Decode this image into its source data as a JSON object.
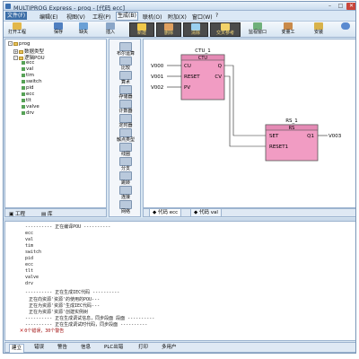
{
  "window": {
    "title": "MULTIPROG Express - prog - [代码 ecc]"
  },
  "menu": {
    "items": [
      "文件(F)",
      "编辑(E)",
      "视图(V)",
      "工程(P)",
      "生成(B)",
      "联机(O)",
      "附加(X)",
      "窗口(W)",
      "?"
    ]
  },
  "toolbar": {
    "buttons": [
      "打开工程",
      "保存",
      "缺失",
      "插入",
      "新建",
      "删除",
      "清除",
      "交叉参考",
      "监视窗口",
      "变量工",
      "安装"
    ]
  },
  "tree": {
    "root": "prog",
    "folder1": "数据类型",
    "folder2": "逻辑POU",
    "items": [
      "ecc",
      "val",
      "tim",
      "switch",
      "pid",
      "ecc",
      "tlt",
      "valve",
      "drv"
    ]
  },
  "left_tabs": {
    "tab1": "工程",
    "tab2": "库"
  },
  "palette": {
    "items": [
      "布尔运算",
      "比较",
      "算术",
      "存储器",
      "计数器",
      "定时器",
      "触点类型",
      "线圈",
      "分支",
      "跳转",
      "连接",
      "网络"
    ]
  },
  "diagram": {
    "block1": {
      "instance": "CTU_1",
      "type": "CTU",
      "inputs": [
        "CU",
        "RESET",
        "PV"
      ],
      "outputs": [
        "Q",
        "CV"
      ],
      "vars_in": [
        "V000",
        "V001",
        "V002"
      ]
    },
    "block2": {
      "instance": "RS_1",
      "type": "RS",
      "inputs": [
        "SET",
        "RESET1"
      ],
      "outputs": [
        "Q1"
      ],
      "var_out": "V003"
    }
  },
  "editor_tabs": {
    "tab1": "代码 ecc",
    "tab2": "代码 val"
  },
  "output": {
    "lines": [
      "---------- 正在编译POU ----------",
      "ecc",
      "val",
      "tim",
      "switch",
      "pid",
      "ecc",
      "tlt",
      "valve",
      "drv",
      "---------- 正在生成IEC代码 ----------",
      "正在向资源'资源'的使用的POU---",
      "正在为资源'资源'生成IEC代码---",
      "正在为资源'资源'创建实例树",
      "---------- 正在生成调试信息，同步段面 段面 ----------",
      "---------- 正在生成调试时代码，同步段面 ----------"
    ],
    "summary": "0个错误，30个警告"
  },
  "bottom_tabs": [
    "建立",
    "错误",
    "警告",
    "信息",
    "PLC出错",
    "打印",
    "多用户"
  ]
}
